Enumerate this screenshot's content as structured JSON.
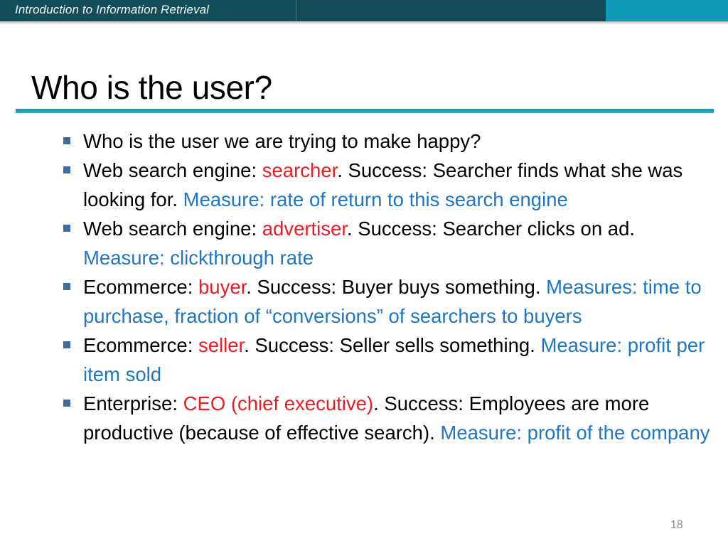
{
  "banner": {
    "title": "Introduction to Information Retrieval",
    "bg_color": "#114b55",
    "accent_color": "#1099b8"
  },
  "slide": {
    "title": "Who is the user?",
    "rule_color": "#1aa0c0",
    "page_number": "18",
    "bullet_marker_color": "#3b6e9e",
    "highlight_red": "#ee1c22",
    "highlight_blue": "#1f76c4"
  },
  "bullets": [
    {
      "segments": [
        {
          "text": "Who is the user we are trying to make happy?",
          "style": "plain"
        }
      ]
    },
    {
      "segments": [
        {
          "text": "Web search engine: ",
          "style": "plain"
        },
        {
          "text": "searcher",
          "style": "red"
        },
        {
          "text": ". Success: Searcher finds what she was looking for. ",
          "style": "plain"
        },
        {
          "text": "Measure: rate of return to this search engine",
          "style": "blue"
        }
      ]
    },
    {
      "segments": [
        {
          "text": "Web search engine: ",
          "style": "plain"
        },
        {
          "text": "advertiser",
          "style": "red"
        },
        {
          "text": ". Success: Searcher clicks on ad. ",
          "style": "plain"
        },
        {
          "text": "Measure: clickthrough rate",
          "style": "blue"
        }
      ]
    },
    {
      "segments": [
        {
          "text": "Ecommerce: ",
          "style": "plain"
        },
        {
          "text": "buyer",
          "style": "red"
        },
        {
          "text": ". Success: Buyer buys something. ",
          "style": "plain"
        },
        {
          "text": "Measures: time to purchase, fraction of “conversions” of searchers to buyers",
          "style": "blue"
        }
      ]
    },
    {
      "segments": [
        {
          "text": "Ecommerce: ",
          "style": "plain"
        },
        {
          "text": "seller",
          "style": "red"
        },
        {
          "text": ". Success: Seller sells something. ",
          "style": "plain"
        },
        {
          "text": "Measure: profit per item sold",
          "style": "blue"
        }
      ]
    },
    {
      "segments": [
        {
          "text": "Enterprise: ",
          "style": "plain"
        },
        {
          "text": "CEO (chief executive)",
          "style": "red"
        },
        {
          "text": ". Success: Employees are more productive (because of effective search). ",
          "style": "plain"
        },
        {
          "text": "Measure: profit of the company",
          "style": "blue"
        }
      ]
    }
  ]
}
